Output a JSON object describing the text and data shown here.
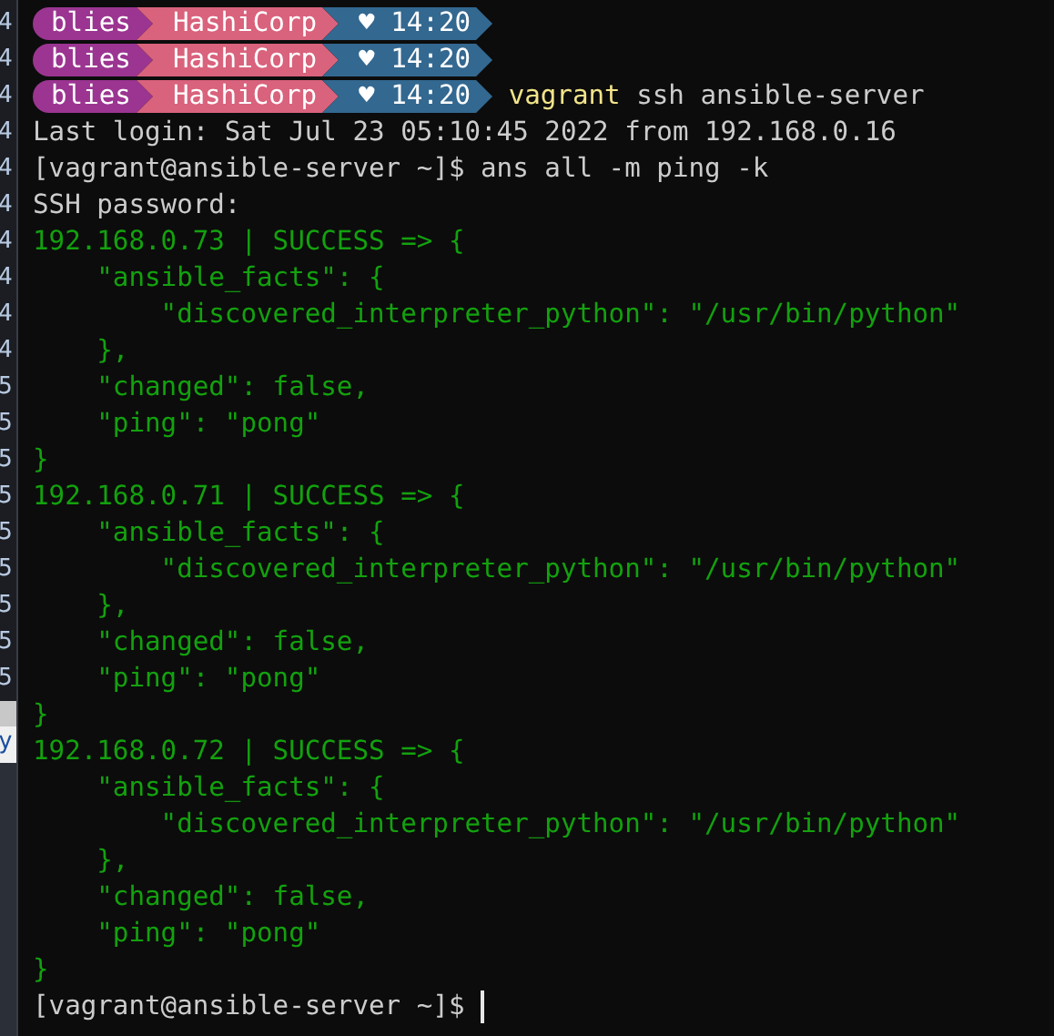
{
  "side_strip": {
    "lines": [
      "4",
      "4",
      "4",
      "4",
      "4",
      "4",
      "4",
      "4",
      "4",
      "4",
      "5",
      "5",
      "5",
      "5",
      "5",
      "5",
      "5",
      "5",
      "5"
    ],
    "footer": "y"
  },
  "prompt_lines": [
    {
      "segments": [
        {
          "text": "blies",
          "color": "#9b3591"
        },
        {
          "text": "HashiCorp",
          "color": "#d9627c"
        },
        {
          "text": "♥ 14:20",
          "color": "#336890"
        }
      ]
    },
    {
      "segments": [
        {
          "text": "blies",
          "color": "#9b3591"
        },
        {
          "text": "HashiCorp",
          "color": "#d9627c"
        },
        {
          "text": "♥ 14:20",
          "color": "#336890"
        }
      ]
    },
    {
      "segments": [
        {
          "text": "blies",
          "color": "#9b3591"
        },
        {
          "text": "HashiCorp",
          "color": "#d9627c"
        },
        {
          "text": "♥ 14:20",
          "color": "#336890"
        }
      ],
      "command": [
        {
          "kind": "program",
          "text": "vagrant"
        },
        {
          "kind": "args",
          "text": " ssh ansible-server"
        }
      ]
    }
  ],
  "output": [
    {
      "kind": "plain",
      "text": "Last login: Sat Jul 23 05:10:45 2022 from 192.168.0.16"
    },
    {
      "kind": "plain",
      "text": "[vagrant@ansible-server ~]$ ans all -m ping -k"
    },
    {
      "kind": "plain",
      "text": "SSH password:"
    },
    {
      "kind": "success",
      "text": "192.168.0.73 | SUCCESS => {"
    },
    {
      "kind": "success",
      "text": "    \"ansible_facts\": {"
    },
    {
      "kind": "success",
      "text": "        \"discovered_interpreter_python\": \"/usr/bin/python\""
    },
    {
      "kind": "success",
      "text": "    },"
    },
    {
      "kind": "success",
      "text": "    \"changed\": false,"
    },
    {
      "kind": "success",
      "text": "    \"ping\": \"pong\""
    },
    {
      "kind": "success",
      "text": "}"
    },
    {
      "kind": "success",
      "text": "192.168.0.71 | SUCCESS => {"
    },
    {
      "kind": "success",
      "text": "    \"ansible_facts\": {"
    },
    {
      "kind": "success",
      "text": "        \"discovered_interpreter_python\": \"/usr/bin/python\""
    },
    {
      "kind": "success",
      "text": "    },"
    },
    {
      "kind": "success",
      "text": "    \"changed\": false,"
    },
    {
      "kind": "success",
      "text": "    \"ping\": \"pong\""
    },
    {
      "kind": "success",
      "text": "}"
    },
    {
      "kind": "success",
      "text": "192.168.0.72 | SUCCESS => {"
    },
    {
      "kind": "success",
      "text": "    \"ansible_facts\": {"
    },
    {
      "kind": "success",
      "text": "        \"discovered_interpreter_python\": \"/usr/bin/python\""
    },
    {
      "kind": "success",
      "text": "    },"
    },
    {
      "kind": "success",
      "text": "    \"changed\": false,"
    },
    {
      "kind": "success",
      "text": "    \"ping\": \"pong\""
    },
    {
      "kind": "success",
      "text": "}"
    }
  ],
  "final_prompt": {
    "text": "[vagrant@ansible-server ~]$ ",
    "cursor": true
  }
}
